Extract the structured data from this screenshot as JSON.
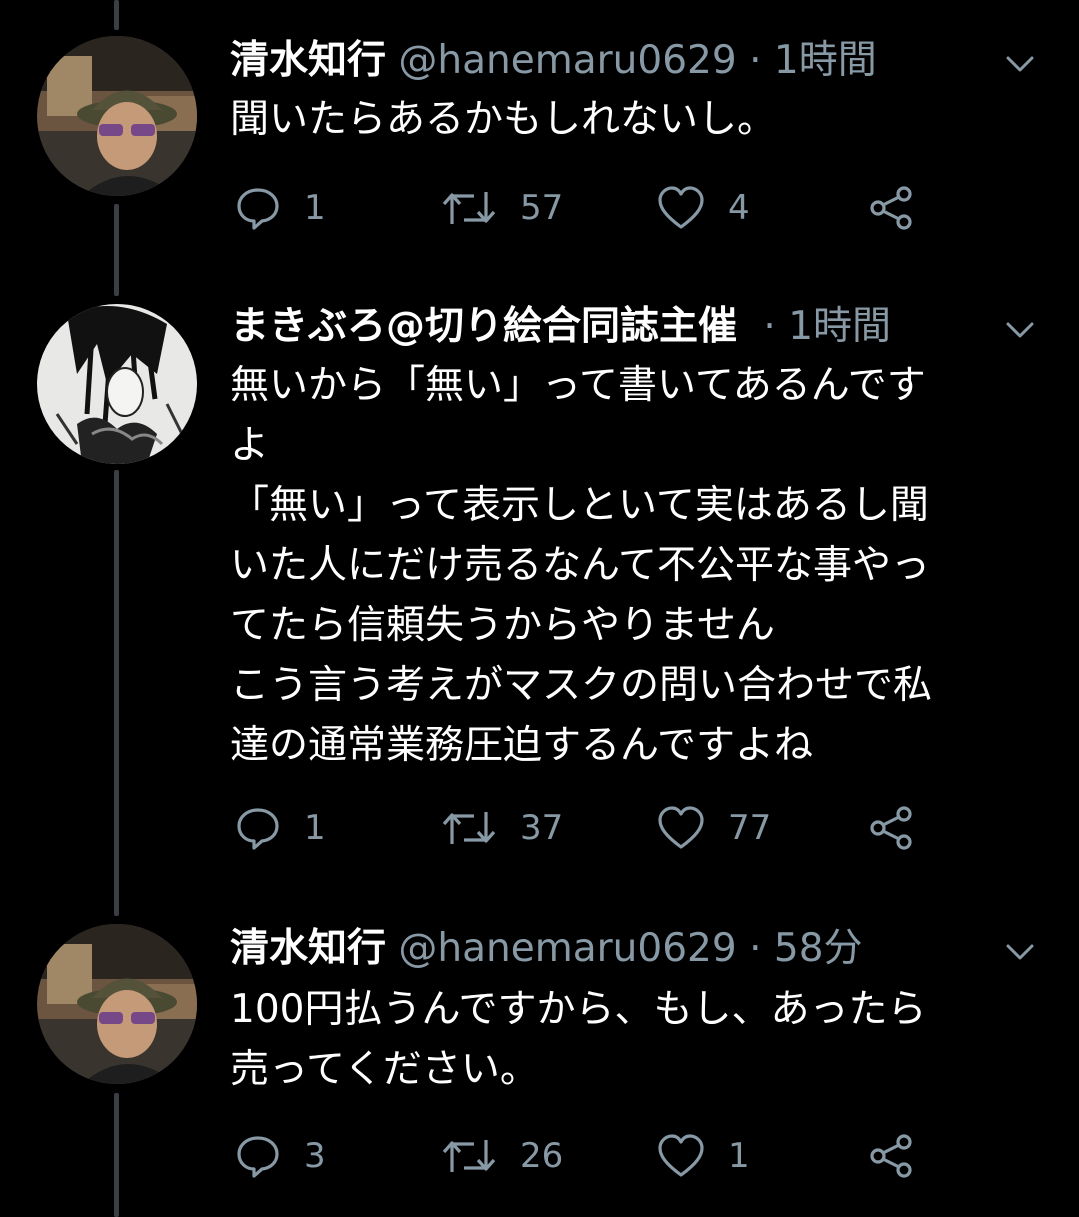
{
  "colors": {
    "background": "#000000",
    "secondary_text": "#8899a6",
    "thread_line": "#3a3f45"
  },
  "tweets": [
    {
      "name": "清水知行",
      "handle": "@hanemaru0629",
      "dot": "·",
      "time": "1時間",
      "lines": [
        "聞いたらあるかもしれないし。"
      ],
      "reply_count": "1",
      "retweet_count": "57",
      "like_count": "4"
    },
    {
      "name": "まきぶろ@切り絵合同誌主催",
      "handle": "",
      "dot": "·",
      "time": "1時間",
      "lines": [
        "無いから「無い」って書いてあるんです",
        "よ",
        "「無い」って表示しといて実はあるし聞",
        "いた人にだけ売るなんて不公平な事やっ",
        "てたら信頼失うからやりません",
        "こう言う考えがマスクの問い合わせで私",
        "達の通常業務圧迫するんですよね"
      ],
      "reply_count": "1",
      "retweet_count": "37",
      "like_count": "77"
    },
    {
      "name": "清水知行",
      "handle": "@hanemaru0629",
      "dot": "·",
      "time": "58分",
      "lines": [
        "100円払うんですから、もし、あったら",
        "売ってください。"
      ],
      "reply_count": "3",
      "retweet_count": "26",
      "like_count": "1"
    }
  ]
}
